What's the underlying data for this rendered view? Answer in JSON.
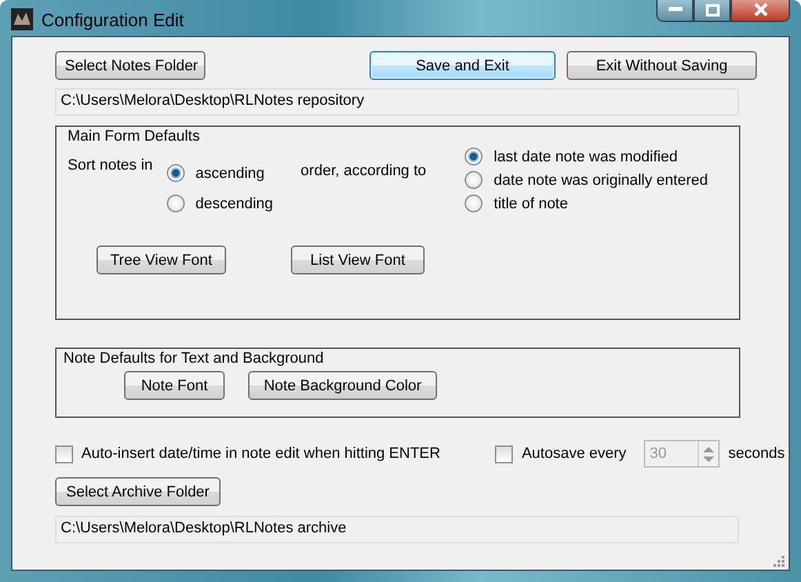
{
  "window": {
    "title": "Configuration Edit"
  },
  "top_buttons": [
    {
      "label": "Select Notes Folder",
      "kind": "normal"
    },
    {
      "label": "Save and Exit",
      "kind": "default"
    },
    {
      "label": "Exit Without Saving",
      "kind": "normal"
    }
  ],
  "notes_folder_path": "C:\\Users\\Melora\\Desktop\\RLNotes repository",
  "main_form_defaults": {
    "title": "Main Form Defaults",
    "sort_label": "Sort notes in",
    "order_label": "order, according to",
    "order_options": [
      {
        "label": "ascending",
        "selected": true
      },
      {
        "label": "descending",
        "selected": false
      }
    ],
    "criteria_options": [
      {
        "label": "last date note was modified",
        "selected": true
      },
      {
        "label": "date note was originally entered",
        "selected": false
      },
      {
        "label": "title of note",
        "selected": false
      }
    ],
    "buttons": [
      "Tree View Font",
      "List View Font"
    ]
  },
  "note_defaults": {
    "title": "Note Defaults for Text and Background",
    "buttons": [
      "Note Font",
      "Note Background Color"
    ]
  },
  "auto_insert": {
    "label": "Auto-insert date/time in note edit when hitting ENTER",
    "checked": false
  },
  "autosave": {
    "label": "Autosave every",
    "checked": false,
    "value": "30",
    "disabled": true,
    "unit": "seconds"
  },
  "archive_button": "Select Archive Folder",
  "archive_path": "C:\\Users\\Melora\\Desktop\\RLNotes archive"
}
